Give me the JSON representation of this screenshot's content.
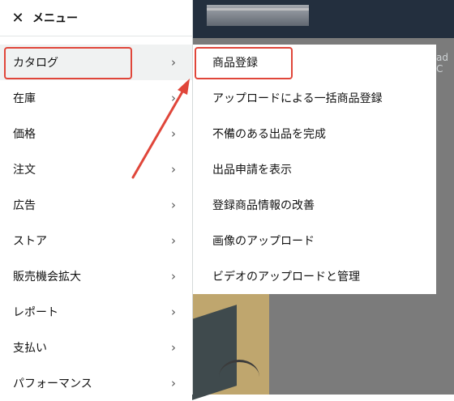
{
  "menu": {
    "title": "メニュー",
    "items": [
      {
        "label": "カタログ"
      },
      {
        "label": "在庫"
      },
      {
        "label": "価格"
      },
      {
        "label": "注文"
      },
      {
        "label": "広告"
      },
      {
        "label": "ストア"
      },
      {
        "label": "販売機会拡大"
      },
      {
        "label": "レポート"
      },
      {
        "label": "支払い"
      },
      {
        "label": "パフォーマンス"
      }
    ]
  },
  "submenu": {
    "items": [
      {
        "label": "商品登録"
      },
      {
        "label": "アップロードによる一括商品登録"
      },
      {
        "label": "不備のある出品を完成"
      },
      {
        "label": "出品申請を表示"
      },
      {
        "label": "登録商品情報の改善"
      },
      {
        "label": "画像のアップロード"
      },
      {
        "label": "ビデオのアップロードと管理"
      }
    ]
  },
  "background": {
    "corner_text": "ad C"
  },
  "colors": {
    "highlight": "#e0463a",
    "header_dark": "#232f3e"
  }
}
